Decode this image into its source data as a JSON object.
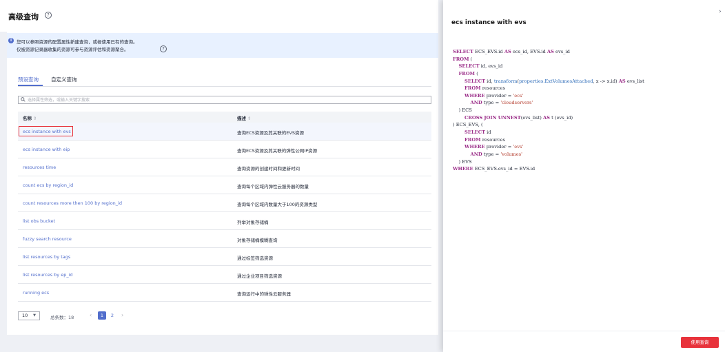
{
  "header": {
    "title": "高级查询",
    "help_glyph": "?"
  },
  "info": {
    "line1": "您可以参照资源的配置属性新建查询，或者使用已有的查询。",
    "line2": "仅被资源记录器收集的资源可参与资源评估和资源聚合。",
    "icon": "info-icon"
  },
  "tabs": [
    {
      "label": "预设查询",
      "active": true
    },
    {
      "label": "自定义查询",
      "active": false
    }
  ],
  "search": {
    "placeholder": "选择属性筛选，或输入关键字搜索"
  },
  "table": {
    "columns": [
      "名称",
      "描述"
    ],
    "sort_glyph": "⇕",
    "rows": [
      {
        "name": "ecs instance with evs",
        "desc": "查询ECS资源及其关联的EVS资源"
      },
      {
        "name": "ecs instance with eip",
        "desc": "查询ECS资源及其关联的弹性公网IP资源"
      },
      {
        "name": "resources time",
        "desc": "查询资源的创建时间和更新时间"
      },
      {
        "name": "count ecs by region_id",
        "desc": "查询每个区域内弹性云服务器的数量"
      },
      {
        "name": "count resources more then 100 by region_id",
        "desc": "查询每个区域内数量大于100的资源类型"
      },
      {
        "name": "list obs bucket",
        "desc": "列举对象存储桶"
      },
      {
        "name": "fuzzy search resource",
        "desc": "对象存储桶模糊查询"
      },
      {
        "name": "list resources by tags",
        "desc": "通过标签筛选资源"
      },
      {
        "name": "list resources by ep_id",
        "desc": "通过企业项目筛选资源"
      },
      {
        "name": "running ecs",
        "desc": "查询运行中的弹性云服务器"
      }
    ]
  },
  "pagination": {
    "page_size": "10",
    "caret": "▼",
    "total": "总条数：18",
    "prev": "‹",
    "next": "›",
    "pages": [
      "1",
      "2"
    ],
    "current": "1"
  },
  "drawer": {
    "title": "ecs instance with evs",
    "close_glyph": "›",
    "use_button": "使用查询",
    "code_lines": [
      "SELECT ECS_EVS.id AS ecs_id, EVS.id AS evs_id",
      "FROM (",
      "    SELECT id, evs_id",
      "    FROM (",
      "        SELECT id, transform(properties.ExtVolumesAttached, x -> x.id) AS evs_list",
      "        FROM resources",
      "        WHERE provider = 'ecs'",
      "            AND type = 'cloudservers'",
      "    ) ECS",
      "        CROSS JOIN UNNEST(evs_list) AS t (evs_id)",
      ") ECS_EVS, (",
      "        SELECT id",
      "        FROM resources",
      "        WHERE provider = 'evs'",
      "            AND type = 'volumes'",
      "    ) EVS",
      "WHERE ECS_EVS.evs_id = EVS.id"
    ]
  },
  "colors": {
    "brand_blue": "#526ecc",
    "danger_red": "#e8323b",
    "info_bg": "#e8f1ff"
  }
}
